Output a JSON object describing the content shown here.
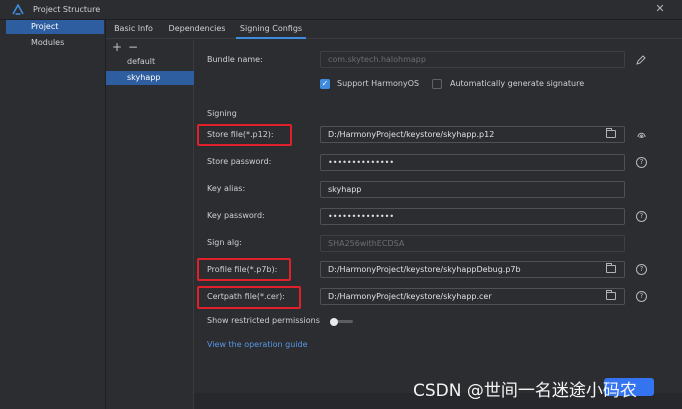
{
  "window": {
    "title": "Project Structure",
    "close_glyph": "✕",
    "logo_icon": "harmonyos-logo-icon"
  },
  "left_nav": {
    "items": [
      {
        "label": "Project",
        "selected": true
      },
      {
        "label": "Modules",
        "selected": false
      }
    ]
  },
  "tabs": [
    {
      "label": "Basic Info"
    },
    {
      "label": "Dependencies"
    },
    {
      "label": "Signing Configs",
      "active": true
    }
  ],
  "modules_panel": {
    "add_glyph": "+",
    "remove_glyph": "−",
    "items": [
      {
        "label": "default"
      },
      {
        "label": "skyhapp",
        "selected": true
      }
    ]
  },
  "form": {
    "bundle_name_label": "Bundle name:",
    "bundle_name_value": "com.skytech.halohmapp",
    "support_harmonyos_label": "Support HarmonyOS",
    "support_harmonyos_checked": true,
    "auto_sign_label": "Automatically generate signature",
    "auto_sign_checked": false,
    "signing_section": "Signing",
    "store_file_label": "Store file(*.p12):",
    "store_file_value": "D:/HarmonyProject/keystore/skyhapp.p12",
    "store_password_label": "Store password:",
    "store_password_value": "••••••••••••••",
    "key_alias_label": "Key alias:",
    "key_alias_value": "skyhapp",
    "key_password_label": "Key password:",
    "key_password_value": "••••••••••••••",
    "sign_alg_label": "Sign alg:",
    "sign_alg_value": "SHA256withECDSA",
    "profile_file_label": "Profile file(*.p7b):",
    "profile_file_value": "D:/HarmonyProject/keystore/skyhappDebug.p7b",
    "certpath_file_label": "Certpath file(*.cer):",
    "certpath_file_value": "D:/HarmonyProject/keystore/skyhapp.cer",
    "show_restricted_label": "Show restricted permissions",
    "show_restricted_on": false,
    "operation_guide_link": "View the operation guide",
    "help_glyph": "?"
  },
  "watermark": "CSDN @世间一名迷途小码农",
  "colors": {
    "accent": "#3d8ce0",
    "selection": "#2e5ea0",
    "highlight_box": "#e0202a",
    "link": "#5897e6"
  }
}
